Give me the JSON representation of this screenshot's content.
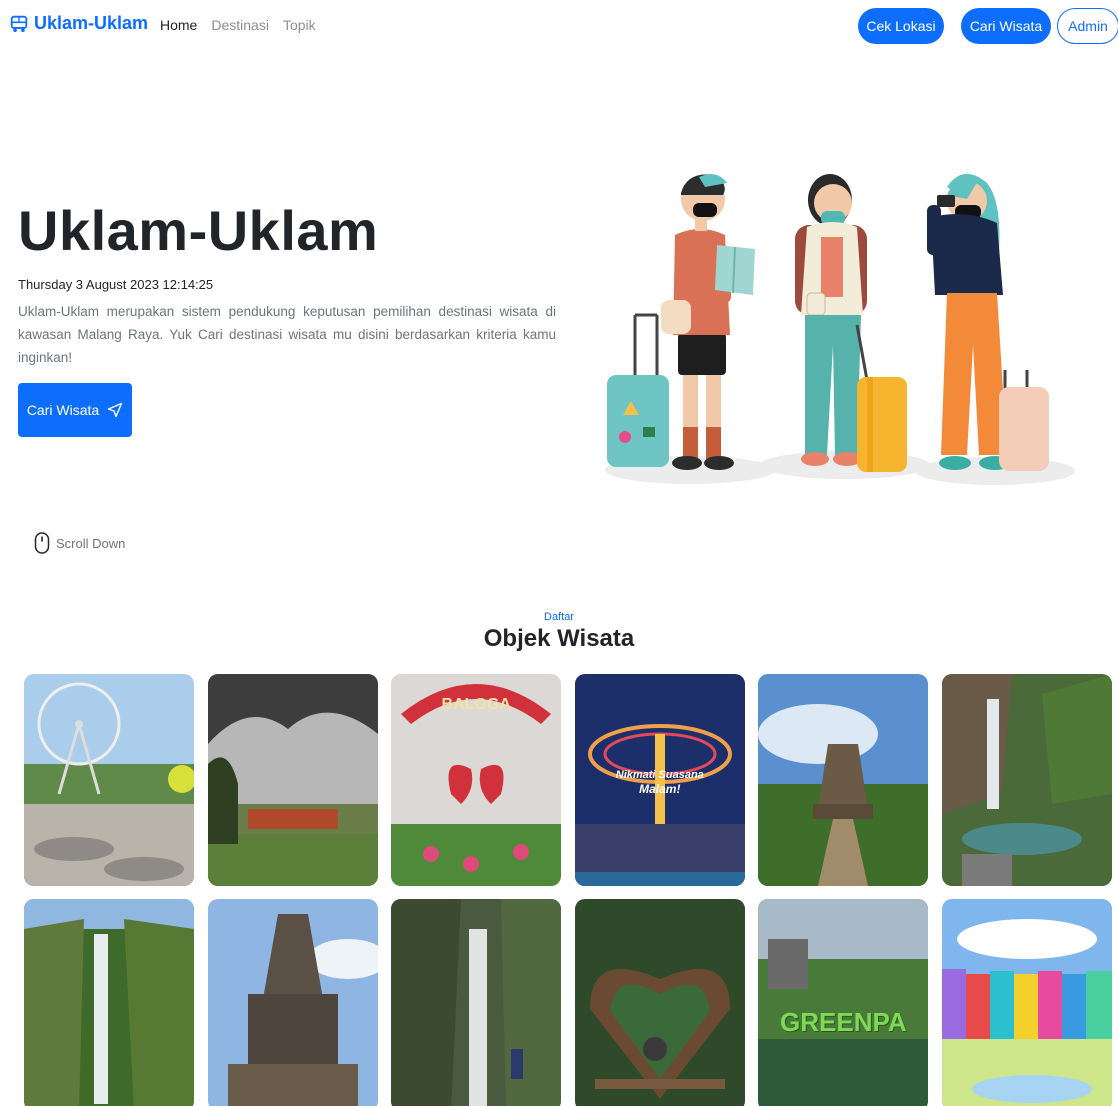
{
  "brand": {
    "name": "Uklam-Uklam",
    "icon": "bus-icon",
    "color": "#0d6efd"
  },
  "nav": {
    "links": [
      "Home",
      "Destinasi",
      "Topik"
    ],
    "active": "Home"
  },
  "nav_buttons": {
    "cek_lokasi": "Cek Lokasi",
    "cari_wisata": "Cari Wisata",
    "admin": "Admin"
  },
  "hero": {
    "title": "Uklam-Uklam",
    "datetime": "Thursday 3 August 2023 12:14:25",
    "description": "Uklam-Uklam merupakan sistem pendukung keputusan pemilihan destinasi wisata di kawasan Malang Raya. Yuk Cari destinasi wisata mu disini berdasarkan kriteria kamu inginkan!",
    "button_label": "Cari Wisata",
    "button_icon": "send-icon"
  },
  "scroll": {
    "label": "Scroll Down",
    "icon": "mouse-icon"
  },
  "section": {
    "subtitle": "Daftar",
    "title": "Objek Wisata"
  },
  "gallery": {
    "card_texts": {
      "baloga": "BALOGA",
      "nikmati": "Nikmati Suasana",
      "malam": "Malam!",
      "greenpa": "GREENPA"
    }
  },
  "colors": {
    "primary": "#0d6efd",
    "text": "#212529",
    "muted": "#6c757d"
  }
}
